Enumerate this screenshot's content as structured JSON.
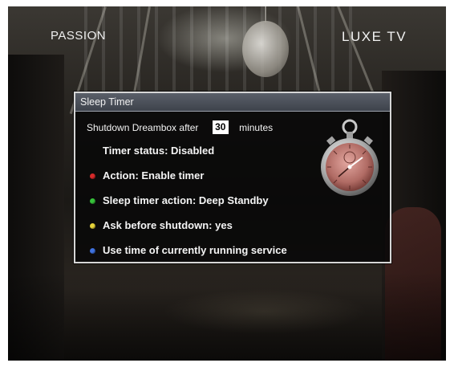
{
  "overlay": {
    "channel_left": "PASSION",
    "channel_right": "LUXE TV"
  },
  "dialog": {
    "title": "Sleep Timer",
    "shutdown_prefix": "Shutdown Dreambox after",
    "minutes_value": "30",
    "minutes_suffix": "minutes",
    "timer_status": "Timer status: Disabled",
    "items": [
      {
        "label": "Action: Enable timer",
        "button_color": "red",
        "color_hex": "#d62a2a"
      },
      {
        "label": "Sleep timer action: Deep Standby",
        "button_color": "green",
        "color_hex": "#37c23a"
      },
      {
        "label": "Ask before shutdown: yes",
        "button_color": "yellow",
        "color_hex": "#e6d43a"
      },
      {
        "label": "Use time of currently running service",
        "button_color": "blue",
        "color_hex": "#3f72e0"
      }
    ],
    "icon": "stopwatch-icon"
  }
}
